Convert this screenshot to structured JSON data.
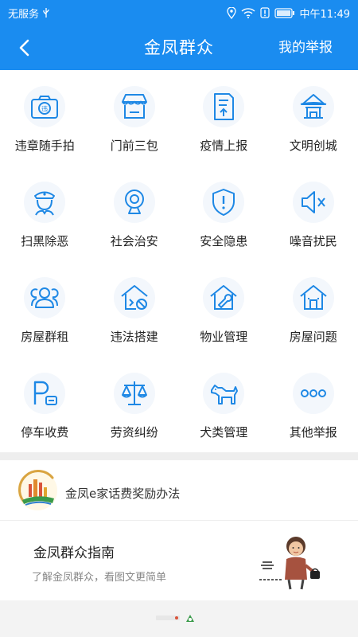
{
  "status_bar": {
    "carrier": "无服务",
    "time": "中午11:49"
  },
  "app_bar": {
    "title": "金凤群众",
    "my_report": "我的举报"
  },
  "grid": [
    {
      "label": "违章随手拍",
      "icon": "camera-icon"
    },
    {
      "label": "门前三包",
      "icon": "storefront-icon"
    },
    {
      "label": "疫情上报",
      "icon": "document-upload-icon"
    },
    {
      "label": "文明创城",
      "icon": "pavilion-icon"
    },
    {
      "label": "扫黑除恶",
      "icon": "police-icon"
    },
    {
      "label": "社会治安",
      "icon": "webcam-icon"
    },
    {
      "label": "安全隐患",
      "icon": "shield-alert-icon"
    },
    {
      "label": "噪音扰民",
      "icon": "speaker-mute-icon"
    },
    {
      "label": "房屋群租",
      "icon": "group-icon"
    },
    {
      "label": "违法搭建",
      "icon": "house-forbidden-icon"
    },
    {
      "label": "物业管理",
      "icon": "house-wrench-icon"
    },
    {
      "label": "房屋问题",
      "icon": "house-icon"
    },
    {
      "label": "停车收费",
      "icon": "parking-icon"
    },
    {
      "label": "劳资纠纷",
      "icon": "scales-icon"
    },
    {
      "label": "犬类管理",
      "icon": "dog-icon"
    },
    {
      "label": "其他举报",
      "icon": "more-icon"
    }
  ],
  "reward": {
    "text": "金凤e家话费奖励办法"
  },
  "guide": {
    "title": "金凤群众指南",
    "subtitle": "了解金凤群众，看图文更简单"
  },
  "colors": {
    "primary": "#1a8cf0",
    "icon_blue": "#1e88e5"
  }
}
